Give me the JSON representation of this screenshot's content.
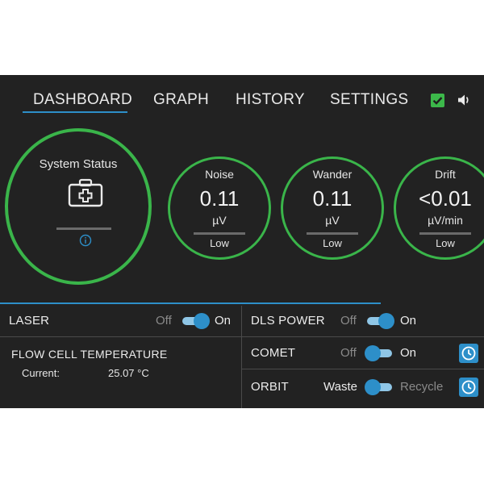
{
  "nav": {
    "tabs": [
      "DASHBOARD",
      "GRAPH",
      "HISTORY",
      "SETTINGS"
    ],
    "active_tab": "DASHBOARD",
    "status_icons": [
      "check-icon",
      "speaker-icon"
    ]
  },
  "system_status": {
    "title": "System Status",
    "icon": "medkit-icon",
    "info_icon": "info-icon"
  },
  "gauges": [
    {
      "title": "Noise",
      "value": "0.11",
      "unit": "µV",
      "level": "Low"
    },
    {
      "title": "Wander",
      "value": "0.11",
      "unit": "µV",
      "level": "Low"
    },
    {
      "title": "Drift",
      "value": "<0.01",
      "unit": "µV/min",
      "level": "Low"
    }
  ],
  "controls": {
    "laser": {
      "label": "LASER",
      "off": "Off",
      "on": "On",
      "state": "on"
    },
    "dls_power": {
      "label": "DLS POWER",
      "off": "Off",
      "on": "On",
      "state": "on"
    },
    "comet": {
      "label": "COMET",
      "off": "Off",
      "on": "On",
      "state": "off"
    },
    "orbit": {
      "label": "ORBIT",
      "off": "Waste",
      "on": "Recycle",
      "state": "off"
    }
  },
  "flow_cell": {
    "title": "FLOW CELL TEMPERATURE",
    "current_label": "Current:",
    "current_value": "25.07 °C"
  },
  "colors": {
    "background": "#222222",
    "ring_green": "#3ab54a",
    "accent_blue": "#2d8fc9",
    "check_green": "#3cb84a"
  }
}
